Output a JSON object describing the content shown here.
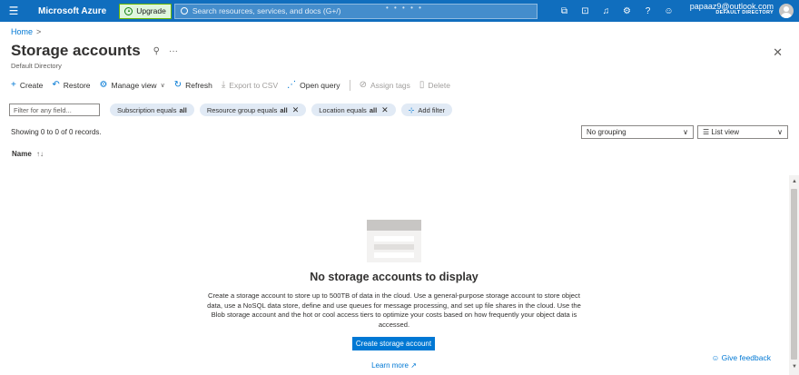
{
  "topbar": {
    "brand": "Microsoft Azure",
    "upgrade_label": "Upgrade",
    "search_placeholder": "Search resources, services, and docs (G+/)",
    "icons": [
      "cloud-shell-icon",
      "directory-filter-icon",
      "notifications-icon",
      "settings-icon",
      "help-icon",
      "feedback-icon"
    ],
    "account_email": "papaaz9@outlook.com",
    "account_directory": "DEFAULT DIRECTORY"
  },
  "breadcrumb": {
    "home": "Home",
    "sep": ">"
  },
  "page": {
    "title": "Storage accounts",
    "subtitle": "Default Directory"
  },
  "toolbar": {
    "create": "Create",
    "restore": "Restore",
    "manage_view": "Manage view",
    "refresh": "Refresh",
    "export_csv": "Export to CSV",
    "open_query": "Open query",
    "assign_tags": "Assign tags",
    "delete": "Delete"
  },
  "filters": {
    "placeholder": "Filter for any field...",
    "subscription_label": "Subscription equals",
    "subscription_value": "all",
    "resource_group_label": "Resource group equals",
    "resource_group_value": "all",
    "location_label": "Location equals",
    "location_value": "all",
    "add_filter": "Add filter"
  },
  "records": {
    "summary": "Showing 0 to 0 of 0 records.",
    "grouping": "No grouping",
    "view": "List view"
  },
  "table": {
    "column_name": "Name",
    "sort_glyph": "↑↓"
  },
  "empty_state": {
    "title": "No storage accounts to display",
    "description": "Create a storage account to store up to 500TB of data in the cloud. Use a general-purpose storage account to store object data, use a NoSQL data store, define and use queues for message processing, and set up file shares in the cloud. Use the Blob storage account and the hot or cool access tiers to optimize your costs based on how frequently your object data is accessed.",
    "cta": "Create storage account",
    "learn_more": "Learn more"
  },
  "feedback": "Give feedback",
  "colors": {
    "topbar": "#106ebe",
    "accent": "#0078d4",
    "pill": "#e1eaf5",
    "text": "#323130"
  }
}
